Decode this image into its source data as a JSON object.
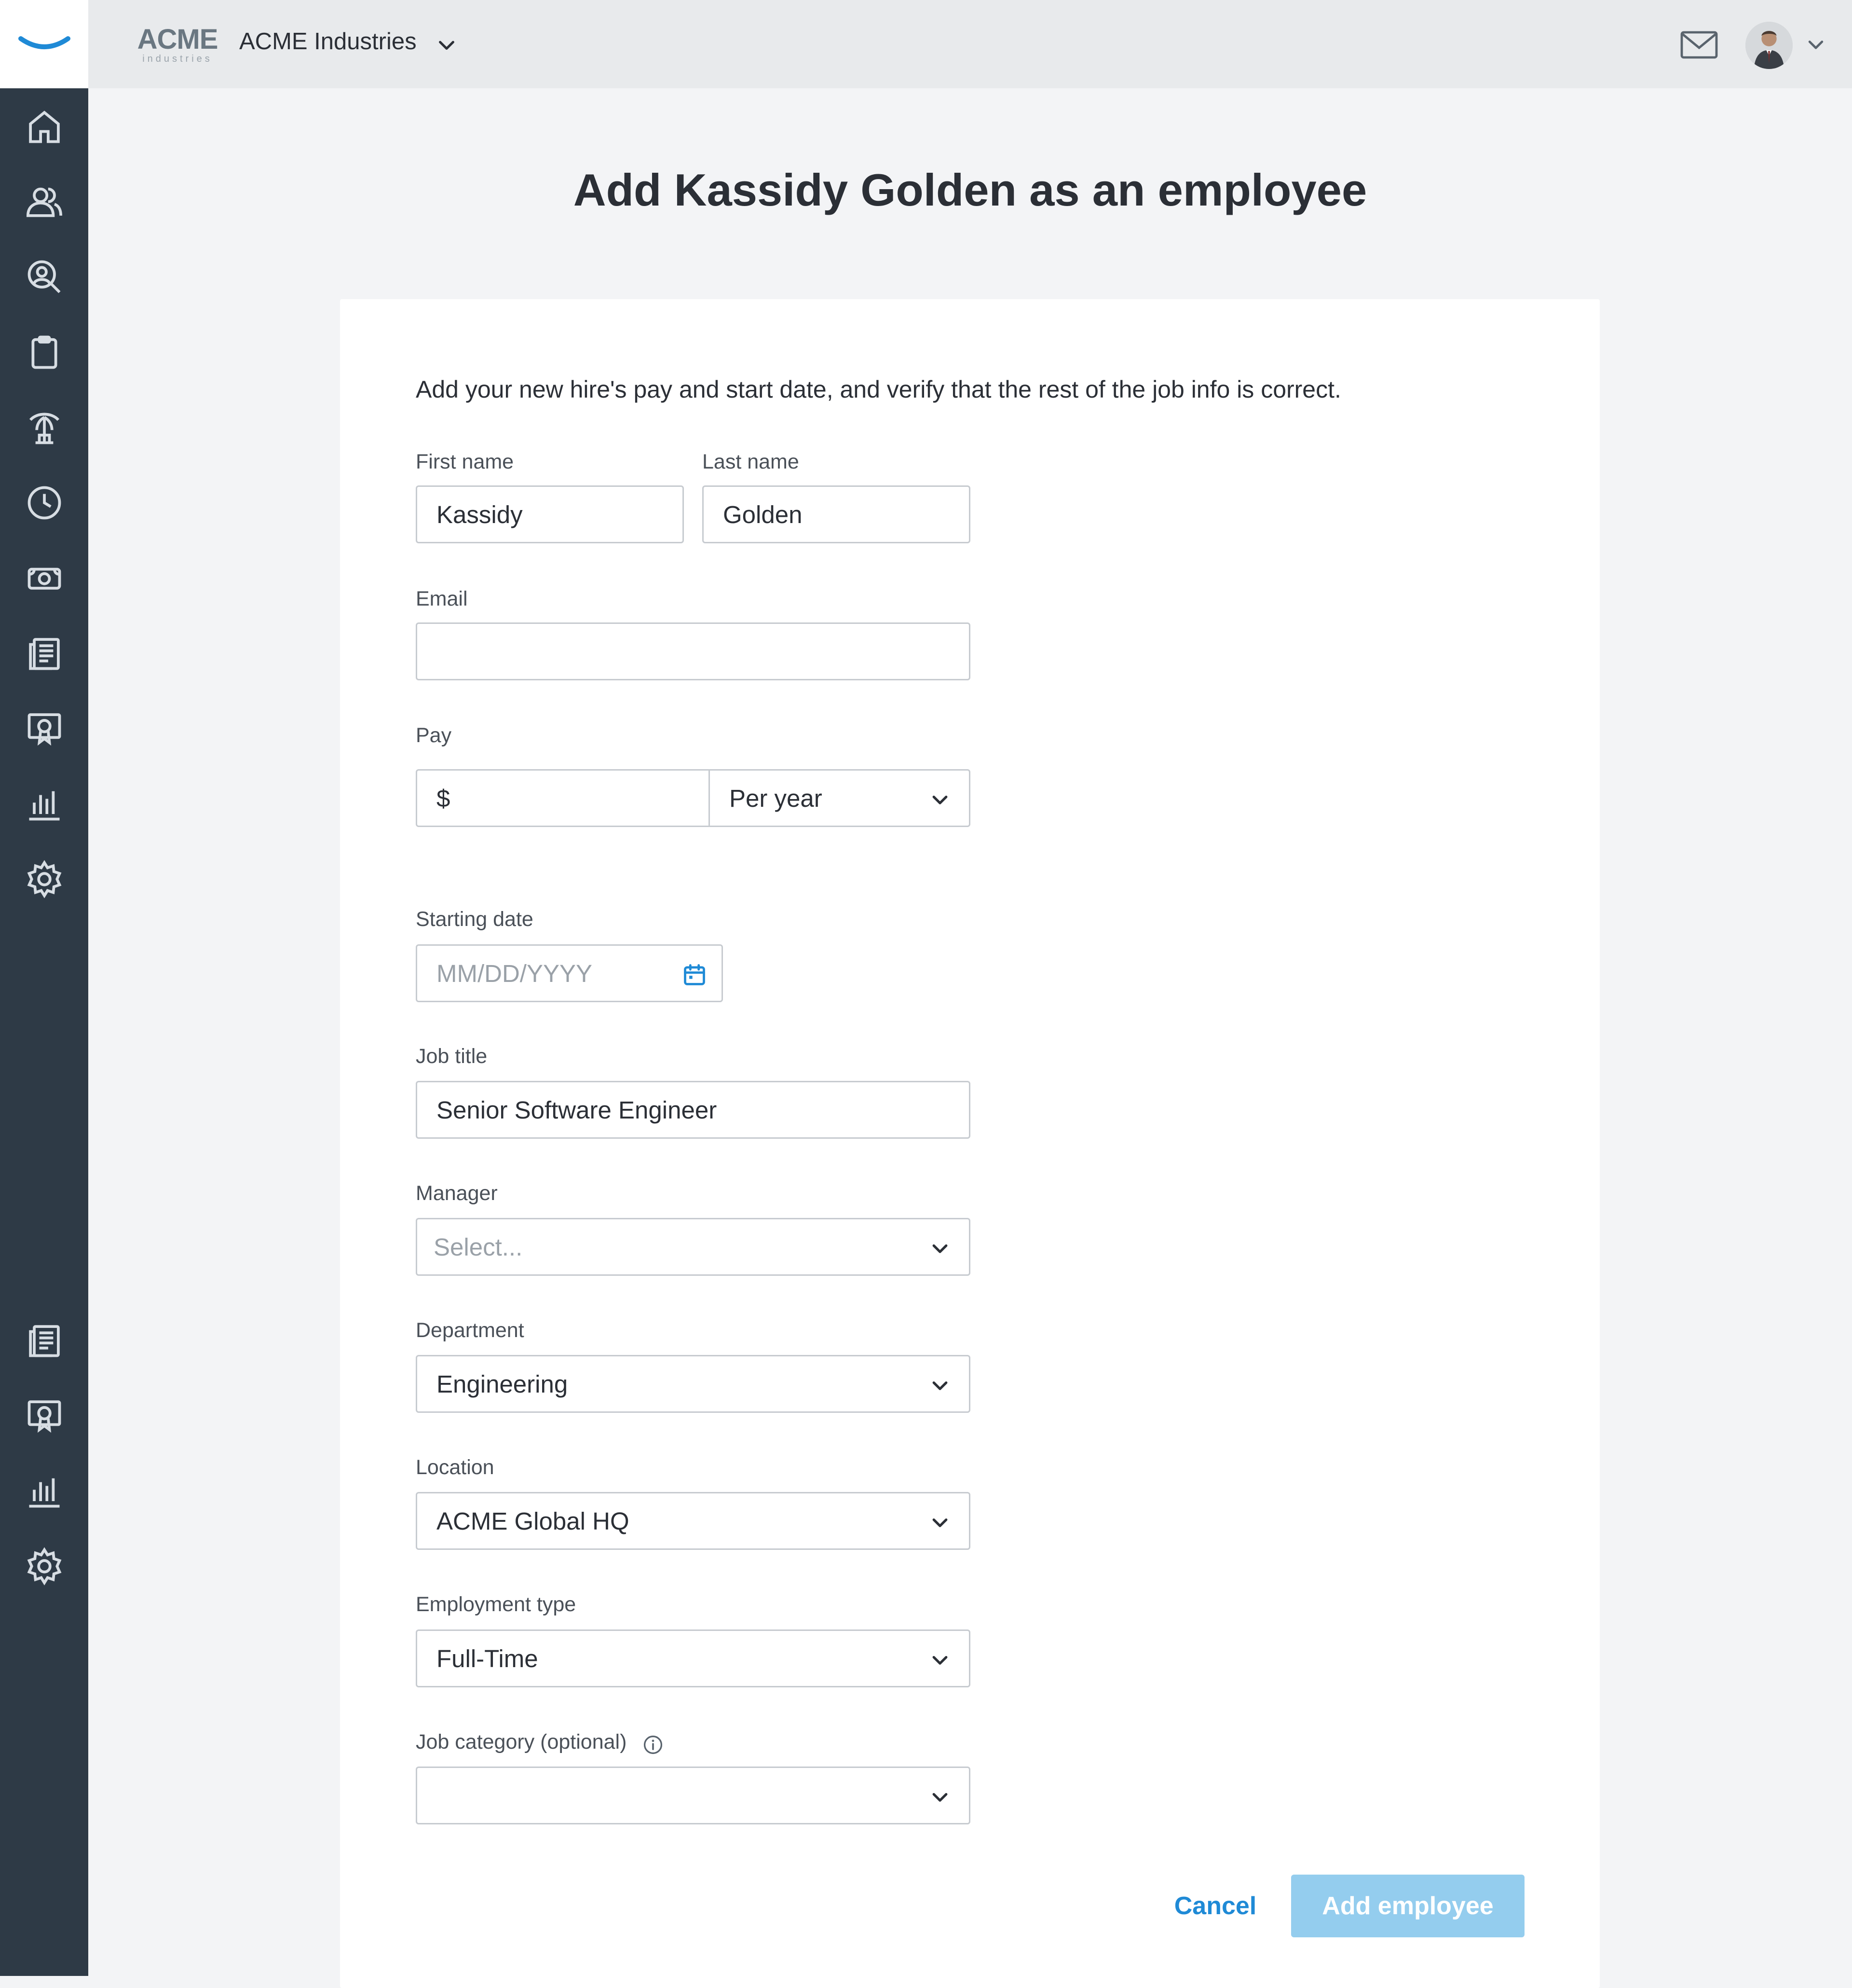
{
  "header": {
    "logo_big": "ACME",
    "logo_small": "industries",
    "company_name": "ACME Industries"
  },
  "page": {
    "title": "Add Kassidy Golden as an employee",
    "intro": "Add your new hire's pay and start date, and verify that the rest of the job info is correct."
  },
  "form": {
    "first_name": {
      "label": "First name",
      "value": "Kassidy"
    },
    "last_name": {
      "label": "Last name",
      "value": "Golden"
    },
    "email": {
      "label": "Email",
      "value": ""
    },
    "pay": {
      "label": "Pay",
      "prefix": "$",
      "value": "",
      "period": "Per year"
    },
    "starting_date": {
      "label": "Starting date",
      "placeholder": "MM/DD/YYYY"
    },
    "job_title": {
      "label": "Job title",
      "value": "Senior Software Engineer"
    },
    "manager": {
      "label": "Manager",
      "placeholder": "Select..."
    },
    "department": {
      "label": "Department",
      "value": "Engineering"
    },
    "location": {
      "label": "Location",
      "value": "ACME Global HQ"
    },
    "employment_type": {
      "label": "Employment type",
      "value": "Full-Time"
    },
    "job_category": {
      "label": "Job category (optional)",
      "value": ""
    }
  },
  "actions": {
    "cancel": "Cancel",
    "submit": "Add employee"
  },
  "sidebar": {
    "icons": [
      "home-icon",
      "people-icon",
      "recruiting-icon",
      "clipboard-icon",
      "time-off-icon",
      "clock-icon",
      "payroll-icon",
      "documents-icon",
      "training-icon",
      "reports-icon",
      "settings-icon",
      "documents-icon",
      "training-icon",
      "reports-icon",
      "settings-icon"
    ]
  },
  "colors": {
    "sidebar": "#2e3a46",
    "accent": "#1f8ad6",
    "button_disabled": "#94cdee",
    "brand_curve": "#1f8ad6"
  }
}
